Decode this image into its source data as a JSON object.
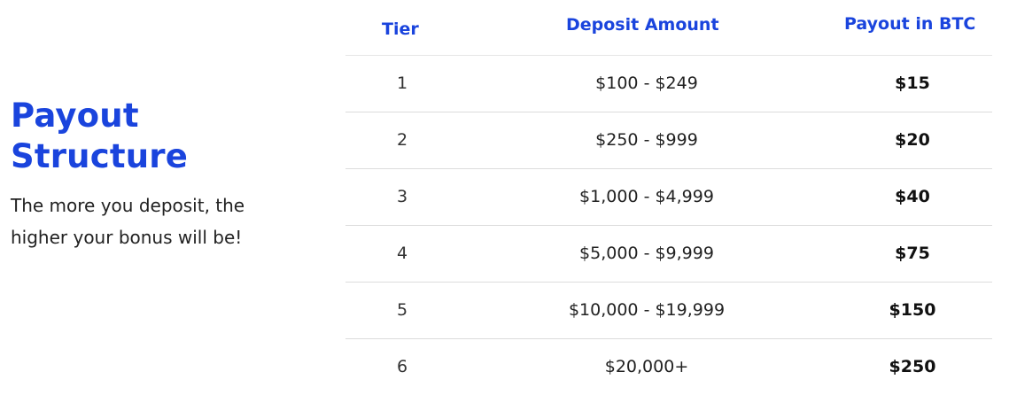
{
  "intro": {
    "title_line1": "Payout",
    "title_line2": "Structure",
    "description": "The more you deposit, the higher your bonus will be!"
  },
  "table": {
    "headers": {
      "tier": "Tier",
      "deposit": "Deposit Amount",
      "payout": "Payout in BTC"
    },
    "rows": [
      {
        "tier": "1",
        "deposit": "$100 - $249",
        "payout": "$15"
      },
      {
        "tier": "2",
        "deposit": "$250 - $999",
        "payout": "$20"
      },
      {
        "tier": "3",
        "deposit": "$1,000 - $4,999",
        "payout": "$40"
      },
      {
        "tier": "4",
        "deposit": "$5,000 - $9,999",
        "payout": "$75"
      },
      {
        "tier": "5",
        "deposit": "$10,000 - $19,999",
        "payout": "$150"
      },
      {
        "tier": "6",
        "deposit": "$20,000+",
        "payout": "$250"
      }
    ]
  },
  "colors": {
    "accent": "#1a44dd",
    "text": "#222222",
    "divider": "#dcdcdc"
  }
}
